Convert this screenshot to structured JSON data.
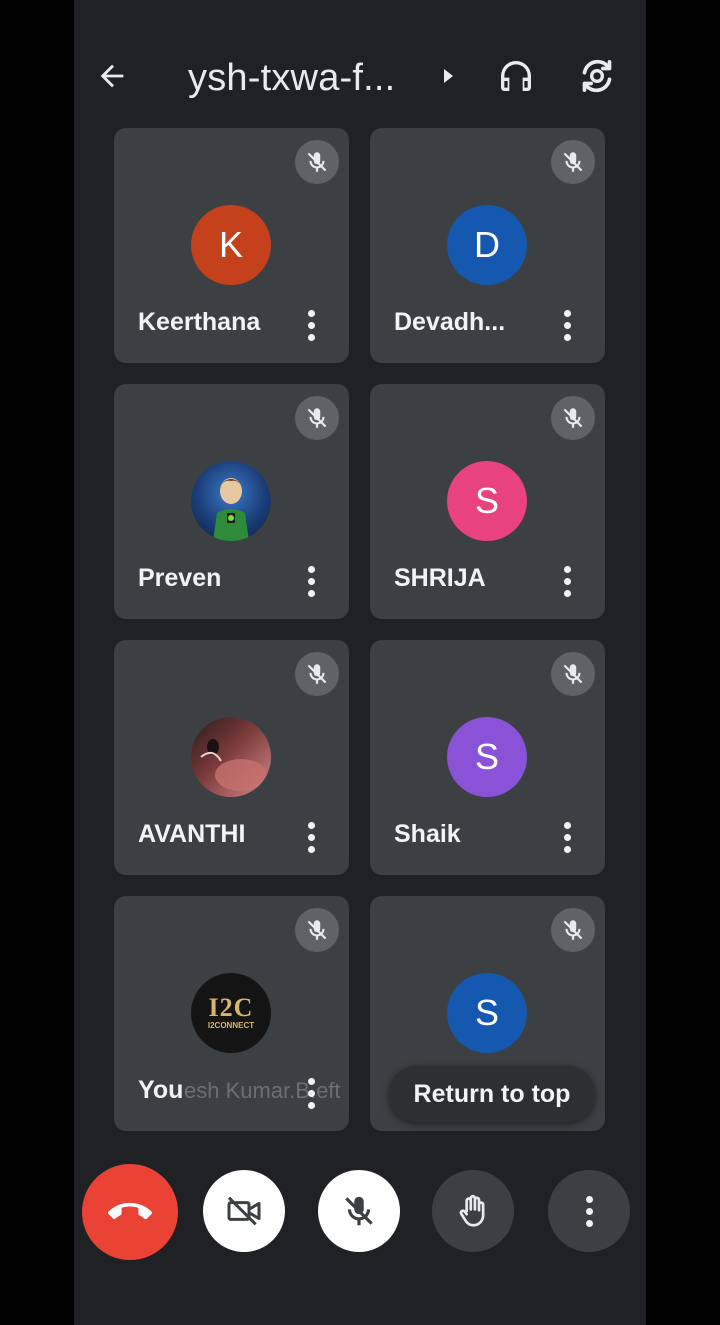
{
  "header": {
    "title": "ysh-txwa-f...",
    "icons": [
      "back-arrow-icon",
      "caret-right-icon",
      "headphones-icon",
      "switch-camera-icon"
    ]
  },
  "participants": [
    {
      "name": "Keerthana",
      "initial": "K",
      "color": "#c5411b",
      "muted": true
    },
    {
      "name": "Devadh...",
      "initial": "D",
      "color": "#1558b0",
      "muted": true
    },
    {
      "name": "Preven",
      "initial": "",
      "avatar": "photo",
      "muted": true
    },
    {
      "name": "SHRIJA",
      "initial": "S",
      "color": "#e8437f",
      "muted": true
    },
    {
      "name": "AVANTHI",
      "initial": "",
      "avatar": "photo",
      "muted": true
    },
    {
      "name": "Shaik",
      "initial": "S",
      "color": "#8a52d6",
      "muted": true
    },
    {
      "name": "You",
      "initial": "",
      "avatar": "logo",
      "logo_text": "I2C",
      "logo_sub": "I2CONNECT",
      "muted": true,
      "faded_label": "esh Kumar.B.eft"
    },
    {
      "name": "",
      "initial": "S",
      "color": "#1558b0",
      "muted": true
    }
  ],
  "overlay": {
    "return_to_top": "Return to top"
  },
  "controls": {
    "buttons": [
      "end-call",
      "camera-off",
      "mic-off",
      "raise-hand",
      "more-options"
    ],
    "colors": {
      "end_call": "#ea4335",
      "active_toggle": "#ffffff",
      "inactive": "#3c4043"
    }
  }
}
